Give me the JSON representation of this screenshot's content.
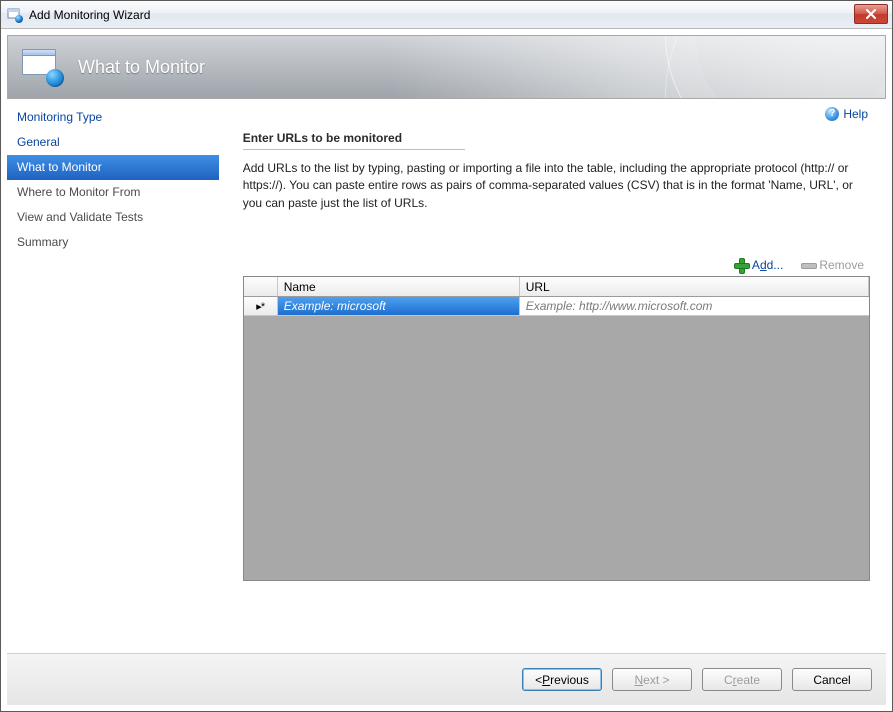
{
  "window": {
    "title": "Add Monitoring Wizard"
  },
  "banner": {
    "title": "What to Monitor"
  },
  "sidebar": {
    "items": [
      {
        "label": "Monitoring Type"
      },
      {
        "label": "General"
      },
      {
        "label": "What to Monitor"
      },
      {
        "label": "Where to Monitor From"
      },
      {
        "label": "View and Validate Tests"
      },
      {
        "label": "Summary"
      }
    ],
    "selected_index": 2
  },
  "main": {
    "help_label": "Help",
    "section_title": "Enter URLs to be monitored",
    "instructions": "Add URLs to the list by typing, pasting or importing a file into the table, including the appropriate protocol (http:// or https://). You can paste entire rows as pairs of comma-separated values (CSV) that is in the format 'Name, URL', or you can paste just the list of URLs.",
    "toolbar": {
      "add_pre": "A",
      "add_u": "d",
      "add_post": "d...",
      "remove_label": "Remove"
    },
    "grid": {
      "columns": {
        "name": "Name",
        "url": "URL"
      },
      "new_row_marker": "▸*",
      "placeholder_row": {
        "name": "Example: microsoft",
        "url": "Example: http://www.microsoft.com"
      }
    }
  },
  "footer": {
    "previous_pre": "< ",
    "previous_u": "P",
    "previous_post": "revious",
    "next_pre": "",
    "next_u": "N",
    "next_post": "ext >",
    "create_pre": "C",
    "create_u": "r",
    "create_post": "eate",
    "cancel_label": "Cancel"
  }
}
